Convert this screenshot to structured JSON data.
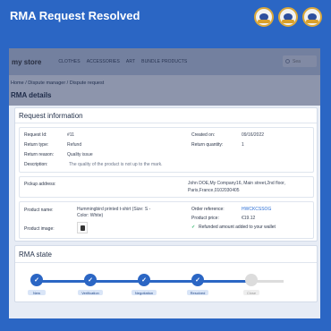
{
  "banner": {
    "title": "RMA Request Resolved",
    "badges": [
      "award-badge-1",
      "award-badge-2",
      "award-badge-3"
    ]
  },
  "header": {
    "logo": "my store",
    "nav": [
      "CLOTHES",
      "ACCESSORIES",
      "ART",
      "BUNDLE PRODUCTS"
    ],
    "search_placeholder": "Sea"
  },
  "breadcrumb": {
    "home": "Home",
    "sep": " / ",
    "manager": "Dispute manager",
    "current": "Dispute request"
  },
  "page_title": "RMA details",
  "request_info": {
    "title": "Request information",
    "request_id_label": "Request Id:",
    "request_id": "#11",
    "created_on_label": "Created on:",
    "created_on": "09/16/2022",
    "return_type_label": "Return type:",
    "return_type": "Refund",
    "return_quantity_label": "Return quantity:",
    "return_quantity": "1",
    "return_reason_label": "Return reason:",
    "return_reason": "Quality issue",
    "description_label": "Description:",
    "description": "The quality of the product is not up to the mark.",
    "pickup_label": "Pickup address:",
    "pickup_line1": "John DOE,My Company16, Main street,2nd floor,",
    "pickup_line2": "Paris,France,0102030405",
    "product_name_label": "Product name:",
    "product_name_line1": "Hummingbird printed t-shirt (Size: S -",
    "product_name_line2": "Color: White)",
    "product_image_label": "Product image:",
    "order_reference_label": "Order reference:",
    "order_reference": "HWCKCSSOG",
    "product_price_label": "Product price:",
    "product_price": "€19.12",
    "refund_status": "Refunded amount added to your wallet"
  },
  "rma_state": {
    "title": "RMA state",
    "steps": [
      {
        "label": "New",
        "done": true
      },
      {
        "label": "Verification",
        "done": true
      },
      {
        "label": "Negotiation",
        "done": true
      },
      {
        "label": "Resolved",
        "done": true
      },
      {
        "label": "Close",
        "done": false
      }
    ]
  },
  "colors": {
    "brand": "#2b66c4",
    "success": "#2fb36a",
    "link": "#2b6fd6"
  }
}
